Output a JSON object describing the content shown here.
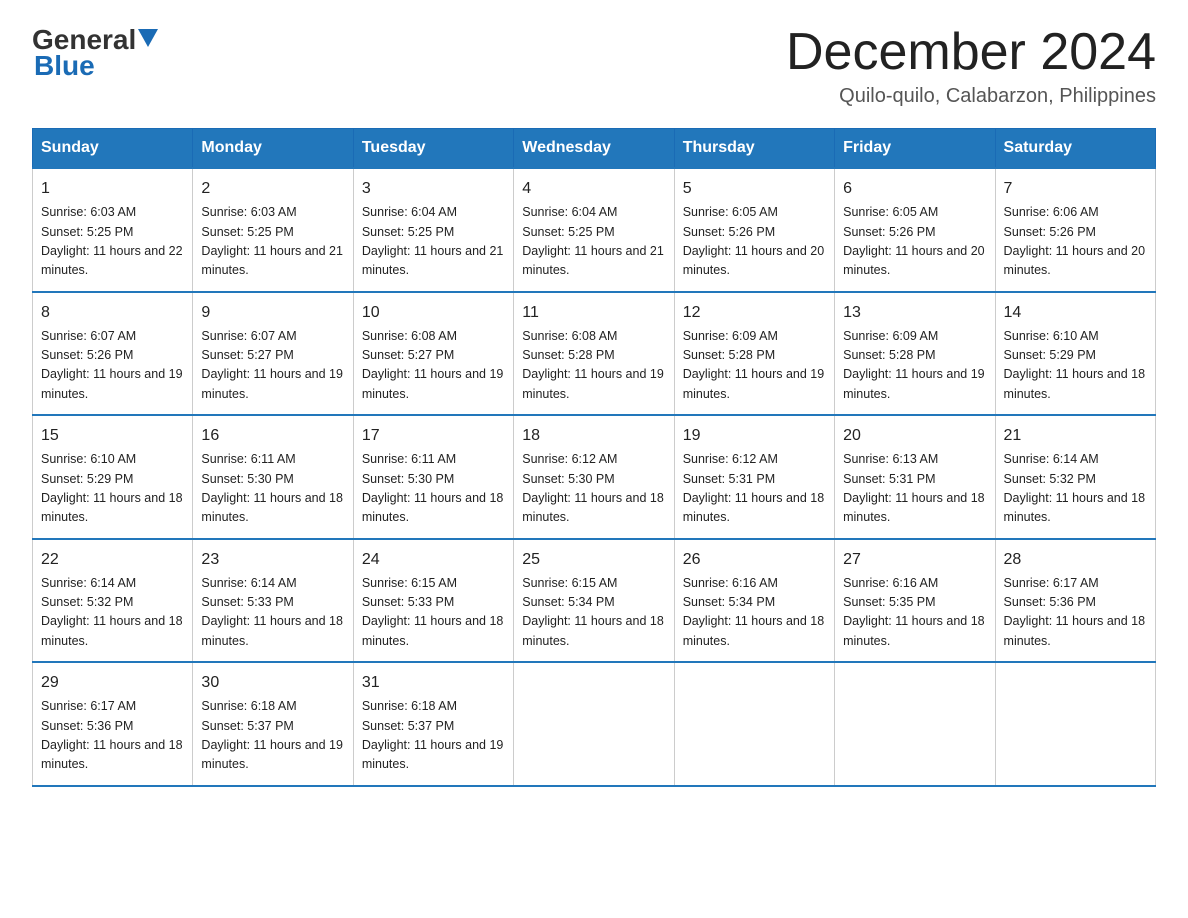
{
  "header": {
    "logo_general": "General",
    "logo_blue": "Blue",
    "month_year": "December 2024",
    "location": "Quilo-quilo, Calabarzon, Philippines"
  },
  "columns": [
    "Sunday",
    "Monday",
    "Tuesday",
    "Wednesday",
    "Thursday",
    "Friday",
    "Saturday"
  ],
  "weeks": [
    [
      {
        "day": "1",
        "sunrise": "6:03 AM",
        "sunset": "5:25 PM",
        "daylight": "11 hours and 22 minutes."
      },
      {
        "day": "2",
        "sunrise": "6:03 AM",
        "sunset": "5:25 PM",
        "daylight": "11 hours and 21 minutes."
      },
      {
        "day": "3",
        "sunrise": "6:04 AM",
        "sunset": "5:25 PM",
        "daylight": "11 hours and 21 minutes."
      },
      {
        "day": "4",
        "sunrise": "6:04 AM",
        "sunset": "5:25 PM",
        "daylight": "11 hours and 21 minutes."
      },
      {
        "day": "5",
        "sunrise": "6:05 AM",
        "sunset": "5:26 PM",
        "daylight": "11 hours and 20 minutes."
      },
      {
        "day": "6",
        "sunrise": "6:05 AM",
        "sunset": "5:26 PM",
        "daylight": "11 hours and 20 minutes."
      },
      {
        "day": "7",
        "sunrise": "6:06 AM",
        "sunset": "5:26 PM",
        "daylight": "11 hours and 20 minutes."
      }
    ],
    [
      {
        "day": "8",
        "sunrise": "6:07 AM",
        "sunset": "5:26 PM",
        "daylight": "11 hours and 19 minutes."
      },
      {
        "day": "9",
        "sunrise": "6:07 AM",
        "sunset": "5:27 PM",
        "daylight": "11 hours and 19 minutes."
      },
      {
        "day": "10",
        "sunrise": "6:08 AM",
        "sunset": "5:27 PM",
        "daylight": "11 hours and 19 minutes."
      },
      {
        "day": "11",
        "sunrise": "6:08 AM",
        "sunset": "5:28 PM",
        "daylight": "11 hours and 19 minutes."
      },
      {
        "day": "12",
        "sunrise": "6:09 AM",
        "sunset": "5:28 PM",
        "daylight": "11 hours and 19 minutes."
      },
      {
        "day": "13",
        "sunrise": "6:09 AM",
        "sunset": "5:28 PM",
        "daylight": "11 hours and 19 minutes."
      },
      {
        "day": "14",
        "sunrise": "6:10 AM",
        "sunset": "5:29 PM",
        "daylight": "11 hours and 18 minutes."
      }
    ],
    [
      {
        "day": "15",
        "sunrise": "6:10 AM",
        "sunset": "5:29 PM",
        "daylight": "11 hours and 18 minutes."
      },
      {
        "day": "16",
        "sunrise": "6:11 AM",
        "sunset": "5:30 PM",
        "daylight": "11 hours and 18 minutes."
      },
      {
        "day": "17",
        "sunrise": "6:11 AM",
        "sunset": "5:30 PM",
        "daylight": "11 hours and 18 minutes."
      },
      {
        "day": "18",
        "sunrise": "6:12 AM",
        "sunset": "5:30 PM",
        "daylight": "11 hours and 18 minutes."
      },
      {
        "day": "19",
        "sunrise": "6:12 AM",
        "sunset": "5:31 PM",
        "daylight": "11 hours and 18 minutes."
      },
      {
        "day": "20",
        "sunrise": "6:13 AM",
        "sunset": "5:31 PM",
        "daylight": "11 hours and 18 minutes."
      },
      {
        "day": "21",
        "sunrise": "6:14 AM",
        "sunset": "5:32 PM",
        "daylight": "11 hours and 18 minutes."
      }
    ],
    [
      {
        "day": "22",
        "sunrise": "6:14 AM",
        "sunset": "5:32 PM",
        "daylight": "11 hours and 18 minutes."
      },
      {
        "day": "23",
        "sunrise": "6:14 AM",
        "sunset": "5:33 PM",
        "daylight": "11 hours and 18 minutes."
      },
      {
        "day": "24",
        "sunrise": "6:15 AM",
        "sunset": "5:33 PM",
        "daylight": "11 hours and 18 minutes."
      },
      {
        "day": "25",
        "sunrise": "6:15 AM",
        "sunset": "5:34 PM",
        "daylight": "11 hours and 18 minutes."
      },
      {
        "day": "26",
        "sunrise": "6:16 AM",
        "sunset": "5:34 PM",
        "daylight": "11 hours and 18 minutes."
      },
      {
        "day": "27",
        "sunrise": "6:16 AM",
        "sunset": "5:35 PM",
        "daylight": "11 hours and 18 minutes."
      },
      {
        "day": "28",
        "sunrise": "6:17 AM",
        "sunset": "5:36 PM",
        "daylight": "11 hours and 18 minutes."
      }
    ],
    [
      {
        "day": "29",
        "sunrise": "6:17 AM",
        "sunset": "5:36 PM",
        "daylight": "11 hours and 18 minutes."
      },
      {
        "day": "30",
        "sunrise": "6:18 AM",
        "sunset": "5:37 PM",
        "daylight": "11 hours and 19 minutes."
      },
      {
        "day": "31",
        "sunrise": "6:18 AM",
        "sunset": "5:37 PM",
        "daylight": "11 hours and 19 minutes."
      },
      null,
      null,
      null,
      null
    ]
  ]
}
